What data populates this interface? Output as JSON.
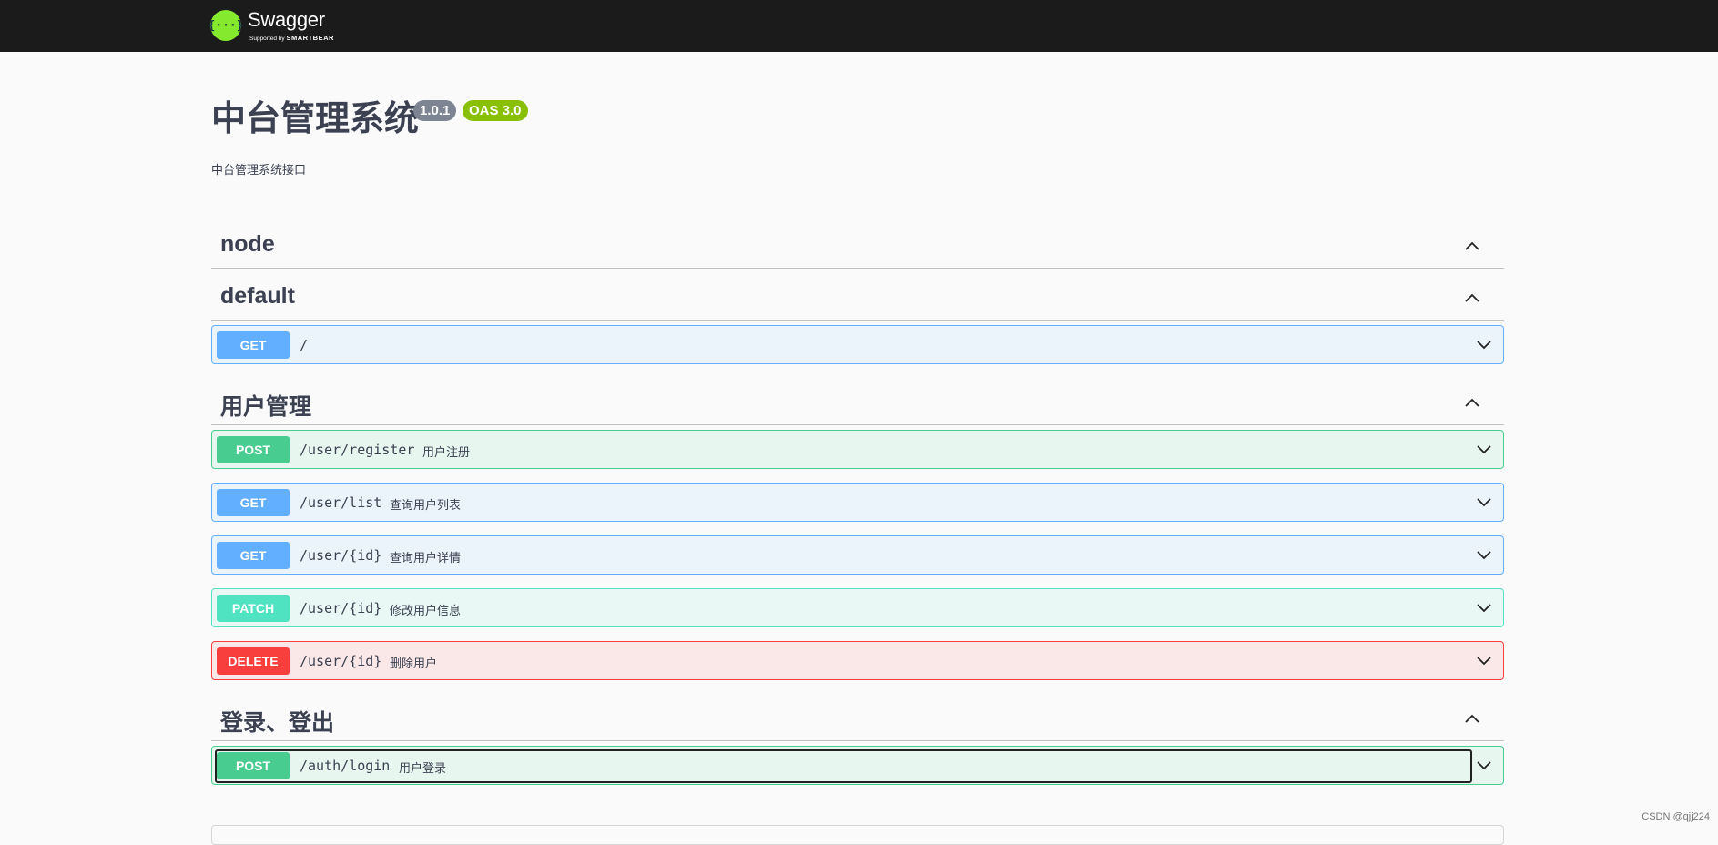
{
  "topbar": {
    "logo_symbol": "{···}",
    "logo_name": "Swagger",
    "logo_supported_by": "Supported by",
    "logo_company": "SMARTBEAR"
  },
  "info": {
    "title": "中台管理系统",
    "version": "1.0.1",
    "oas": "OAS 3.0",
    "description": "中台管理系统接口"
  },
  "tags": [
    {
      "name": "node",
      "expanded": true,
      "operations": []
    },
    {
      "name": "default",
      "expanded": true,
      "operations": [
        {
          "method": "GET",
          "path": "/",
          "summary": ""
        }
      ]
    },
    {
      "name": "用户管理",
      "expanded": true,
      "operations": [
        {
          "method": "POST",
          "path": "/user/register",
          "summary": "用户注册"
        },
        {
          "method": "GET",
          "path": "/user/list",
          "summary": "查询用户列表"
        },
        {
          "method": "GET",
          "path": "/user/{id}",
          "summary": "查询用户详情"
        },
        {
          "method": "PATCH",
          "path": "/user/{id}",
          "summary": "修改用户信息"
        },
        {
          "method": "DELETE",
          "path": "/user/{id}",
          "summary": "删除用户"
        }
      ]
    },
    {
      "name": "登录、登出",
      "expanded": true,
      "operations": [
        {
          "method": "POST",
          "path": "/auth/login",
          "summary": "用户登录"
        }
      ]
    }
  ],
  "colors": {
    "topbar": "#1b1b1b",
    "logo": "#85ea2d",
    "get": "#61affe",
    "post": "#49cc90",
    "patch": "#50e3c2",
    "delete": "#f93e3e",
    "version_badge": "#7d8492",
    "oas_badge": "#89bf04"
  },
  "icons": {
    "tag_toggle": "chevron-up-icon",
    "op_toggle": "chevron-down-icon"
  },
  "watermark": "CSDN @qjj224"
}
